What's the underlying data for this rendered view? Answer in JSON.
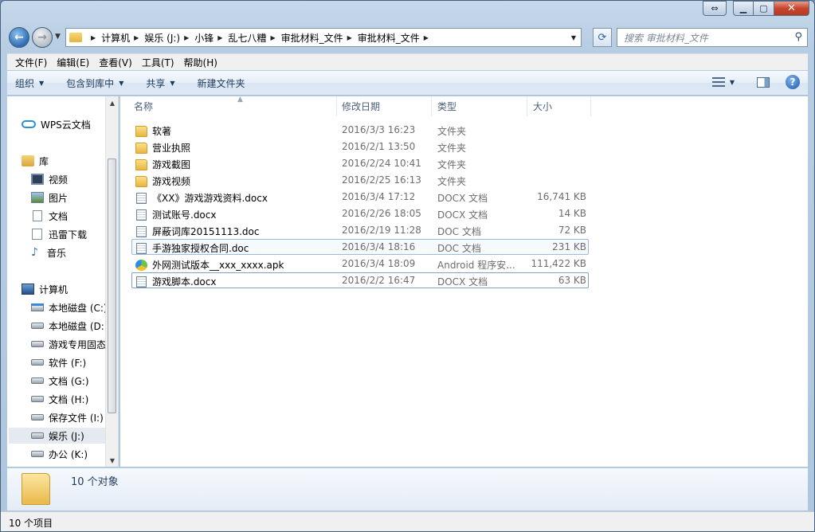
{
  "address": {
    "crumbs": [
      "计算机",
      "娱乐 (J:)",
      "小锋",
      "乱七八糟",
      "审批材料_文件",
      "审批材料_文件"
    ]
  },
  "search": {
    "placeholder": "搜索 审批材料_文件"
  },
  "menu": [
    "文件(F)",
    "编辑(E)",
    "查看(V)",
    "工具(T)",
    "帮助(H)"
  ],
  "toolbar": {
    "organize": "组织",
    "include_library": "包含到库中",
    "share": "共享",
    "new_folder": "新建文件夹"
  },
  "nav": {
    "wps": "WPS云文档",
    "libraries": "库",
    "video": "视频",
    "pictures": "图片",
    "documents": "文档",
    "xunlei": "迅雷下载",
    "music": "音乐",
    "computer": "计算机",
    "drives": [
      "本地磁盘 (C:)",
      "本地磁盘 (D:)",
      "游戏专用固态",
      "软件 (F:)",
      "文档 (G:)",
      "文档 (H:)",
      "保存文件 (I:)",
      "娱乐 (J:)",
      "办公 (K:)"
    ],
    "selected_drive": "娱乐 (J:)"
  },
  "columns": {
    "name": "名称",
    "date": "修改日期",
    "type": "类型",
    "size": "大小"
  },
  "files": [
    {
      "icon": "folder-icon",
      "name": "软著",
      "date": "2016/3/3 16:23",
      "type": "文件夹",
      "size": ""
    },
    {
      "icon": "folder-icon",
      "name": "营业执照",
      "date": "2016/2/1 13:50",
      "type": "文件夹",
      "size": ""
    },
    {
      "icon": "folder-icon",
      "name": "游戏截图",
      "date": "2016/2/24 10:41",
      "type": "文件夹",
      "size": ""
    },
    {
      "icon": "folder-icon",
      "name": "游戏视频",
      "date": "2016/2/25 16:13",
      "type": "文件夹",
      "size": ""
    },
    {
      "icon": "docx-icon",
      "name": "《XX》游戏游戏资料.docx",
      "date": "2016/3/4 17:12",
      "type": "DOCX 文档",
      "size": "16,741 KB"
    },
    {
      "icon": "docx-icon",
      "name": "测试账号.docx",
      "date": "2016/2/26 18:05",
      "type": "DOCX 文档",
      "size": "14 KB"
    },
    {
      "icon": "doc-icon",
      "name": "屏蔽词库20151113.doc",
      "date": "2016/2/19 11:28",
      "type": "DOC 文档",
      "size": "72 KB"
    },
    {
      "icon": "doc-icon",
      "name": "手游独家授权合同.doc",
      "date": "2016/3/4 18:16",
      "type": "DOC 文档",
      "size": "231 KB"
    },
    {
      "icon": "apk-icon",
      "name": "外网测试版本__xxx_xxxx.apk",
      "date": "2016/3/4 18:09",
      "type": "Android 程序安...",
      "size": "111,422 KB"
    },
    {
      "icon": "docx-icon",
      "name": "游戏脚本.docx",
      "date": "2016/2/2 16:47",
      "type": "DOCX 文档",
      "size": "63 KB"
    }
  ],
  "details": {
    "count": "10 个对象"
  },
  "status": {
    "items": "10 个项目"
  }
}
